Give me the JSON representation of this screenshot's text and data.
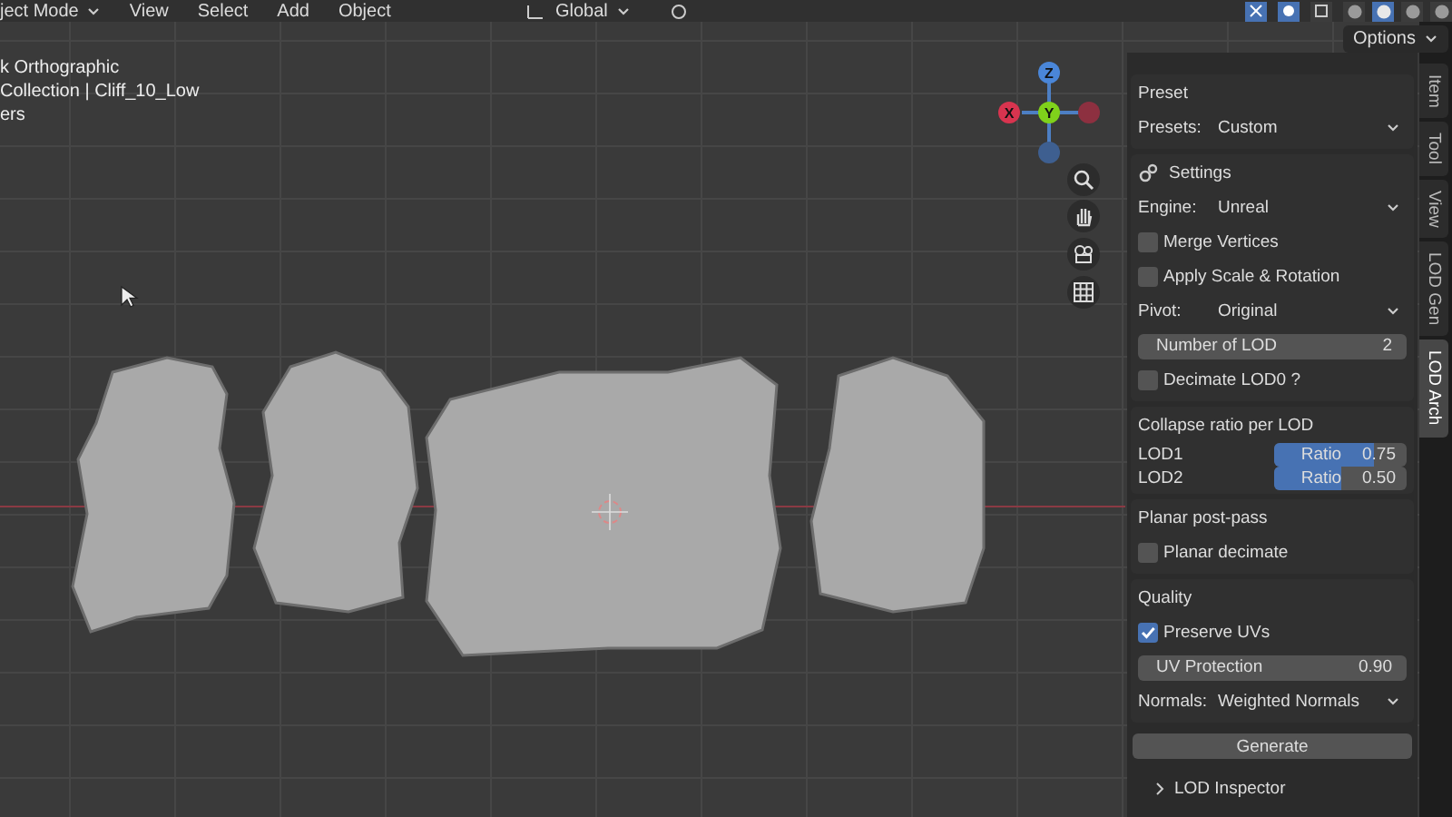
{
  "header": {
    "menus": [
      {
        "label": "ject Mode",
        "kind": "dropdown"
      },
      {
        "label": "View",
        "kind": "menu"
      },
      {
        "label": "Select",
        "kind": "menu"
      },
      {
        "label": "Add",
        "kind": "menu"
      },
      {
        "label": "Object",
        "kind": "menu"
      }
    ],
    "orientation": "Global",
    "shading_modes": [
      {
        "selected": false
      },
      {
        "selected": true
      },
      {
        "selected": false
      },
      {
        "selected": false
      }
    ]
  },
  "viewport": {
    "view_name": "k Orthographic",
    "collection": "Collection | Cliff_10_Low",
    "line_3": "ers",
    "gizmo": {
      "z": "Z",
      "x": "X",
      "y": "Y"
    }
  },
  "options_button": "Options",
  "sections": [
    {
      "title": "Preset",
      "kind": "plain",
      "rows": [
        {
          "kind": "dropdown",
          "label": "Presets:",
          "value": "Custom"
        }
      ]
    },
    {
      "title": "Settings",
      "kind": "with_icon",
      "rows": [
        {
          "kind": "dropdown",
          "label": "Engine:",
          "value": "Unreal"
        },
        {
          "kind": "checkbox",
          "label": "Merge Vertices",
          "checked": false
        },
        {
          "kind": "checkbox",
          "label": "Apply Scale & Rotation",
          "checked": false
        },
        {
          "kind": "dropdown",
          "label": "Pivot:",
          "value": "Original"
        },
        {
          "kind": "number",
          "label": "Number of LOD",
          "value": "2"
        },
        {
          "kind": "checkbox",
          "label": "Decimate LOD0 ?",
          "checked": false
        }
      ]
    },
    {
      "title": "Collapse ratio per LOD",
      "kind": "plain",
      "rows": [
        {
          "kind": "ratio",
          "label": "LOD1",
          "field": "Ratio",
          "value": "0.75",
          "level": 0.75
        },
        {
          "kind": "ratio",
          "label": "LOD2",
          "field": "Ratio",
          "value": "0.50",
          "level": 0.5
        }
      ]
    },
    {
      "title": "Planar post-pass",
      "kind": "plain",
      "rows": [
        {
          "kind": "checkbox",
          "label": "Planar decimate",
          "checked": false
        }
      ]
    },
    {
      "title": "Quality",
      "kind": "plain",
      "rows": [
        {
          "kind": "checkbox",
          "label": "Preserve UVs",
          "checked": true
        },
        {
          "kind": "number",
          "label": "UV Protection",
          "value": "0.90"
        },
        {
          "kind": "dropdown",
          "label": "Normals:",
          "value": "Weighted Normals"
        }
      ]
    }
  ],
  "generate_button": "Generate",
  "subpanels": [
    {
      "label": "LOD Inspector",
      "expanded": false
    }
  ],
  "tabs": [
    {
      "label": "Item",
      "selected": false
    },
    {
      "label": "Tool",
      "selected": false
    },
    {
      "label": "View",
      "selected": false
    },
    {
      "label": "LOD Gen",
      "selected": false
    },
    {
      "label": "LOD Arch",
      "selected": true
    }
  ]
}
